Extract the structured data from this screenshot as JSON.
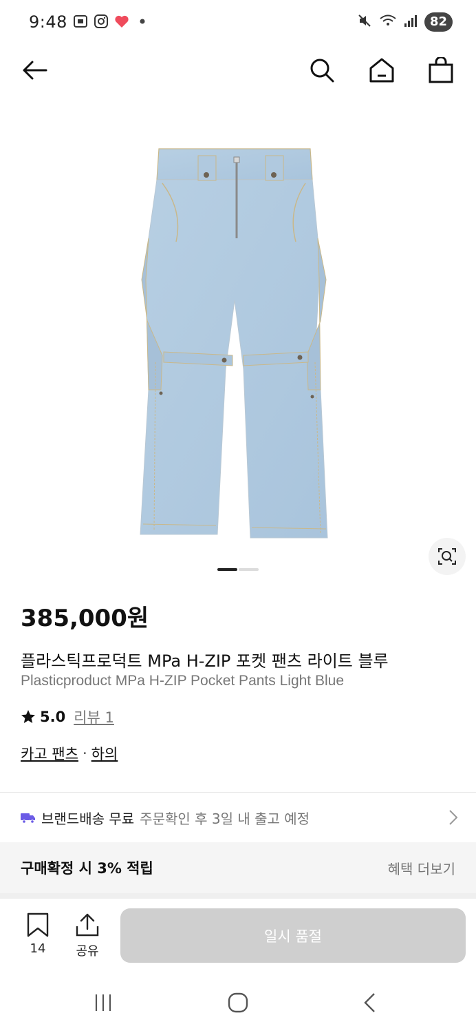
{
  "status_bar": {
    "time": "9:48",
    "battery": "82",
    "left_icons": [
      "screenshot-icon",
      "instagram-icon",
      "heart-icon",
      "dot-icon"
    ],
    "right_icons": [
      "mute-icon",
      "wifi-icon",
      "signal-icon"
    ]
  },
  "nav": {
    "icons": [
      "back-arrow-icon",
      "search-icon",
      "home-icon",
      "shopping-bag-icon"
    ]
  },
  "product": {
    "image_description_icon": "jeans-image",
    "carousel": {
      "total": 2,
      "active": 1
    },
    "price": "385,000원",
    "title_ko": "플라스틱프로덕트 MPa H-ZIP 포켓 팬츠 라이트 블루",
    "title_en": "Plasticproduct MPa H-ZIP Pocket Pants Light Blue",
    "rating": "5.0",
    "review_link": "리뷰 1",
    "category_1": "카고 팬츠",
    "category_sep": "·",
    "category_2": "하의"
  },
  "shipping": {
    "strong": "브랜드배송 무료",
    "sub": "주문확인 후 3일 내 출고 예정"
  },
  "benefit": {
    "title": "구매확정 시 3% 적립",
    "more": "혜택 더보기"
  },
  "action_bar": {
    "wish_count": "14",
    "share_label": "공유",
    "soldout_label": "일시 품절"
  },
  "colors": {
    "accent_truck": "#6b5be6",
    "soldout_bg": "#cfcfcf"
  }
}
